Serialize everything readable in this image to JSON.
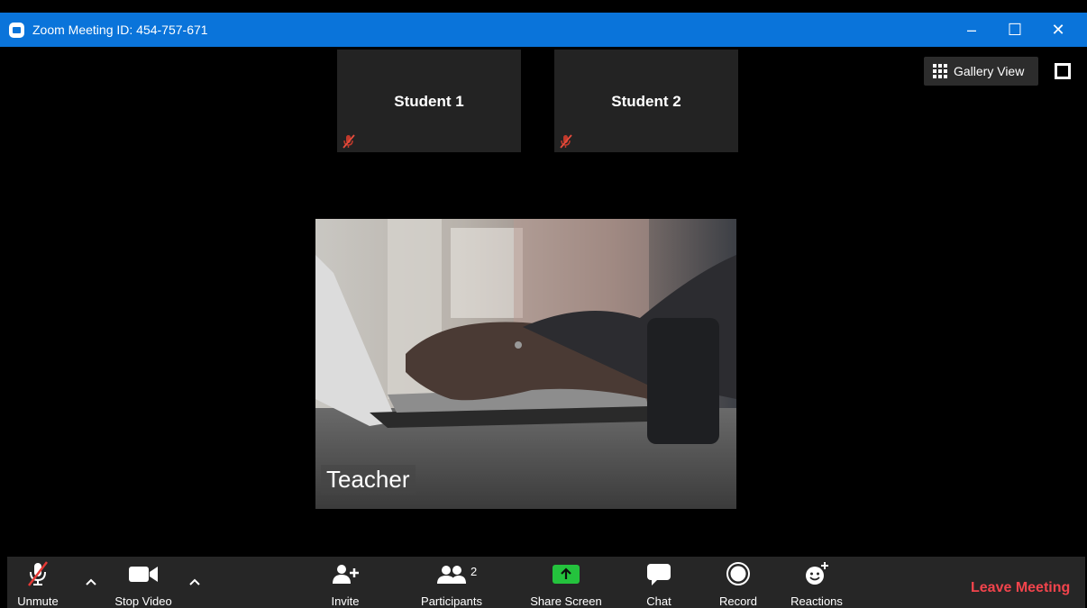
{
  "window": {
    "title": "Zoom Meeting ID: 454-757-671",
    "accent": "#0a74da"
  },
  "controls": {
    "minimize": "–",
    "maximize": "☐",
    "close": "✕"
  },
  "view": {
    "gallery_label": "Gallery View"
  },
  "participants_tiles": [
    {
      "name": "Student 1",
      "muted": true
    },
    {
      "name": "Student 2",
      "muted": true
    }
  ],
  "active_speaker": {
    "name": "Teacher"
  },
  "toolbar": {
    "unmute": "Unmute",
    "stop_video": "Stop Video",
    "invite": "Invite",
    "participants": "Participants",
    "participants_count": "2",
    "share_screen": "Share Screen",
    "chat": "Chat",
    "record": "Record",
    "reactions": "Reactions",
    "leave": "Leave Meeting"
  },
  "colors": {
    "leave": "#f2444c",
    "share": "#24c23d",
    "toolbar_bg": "#262626",
    "tile_bg": "#232323"
  }
}
